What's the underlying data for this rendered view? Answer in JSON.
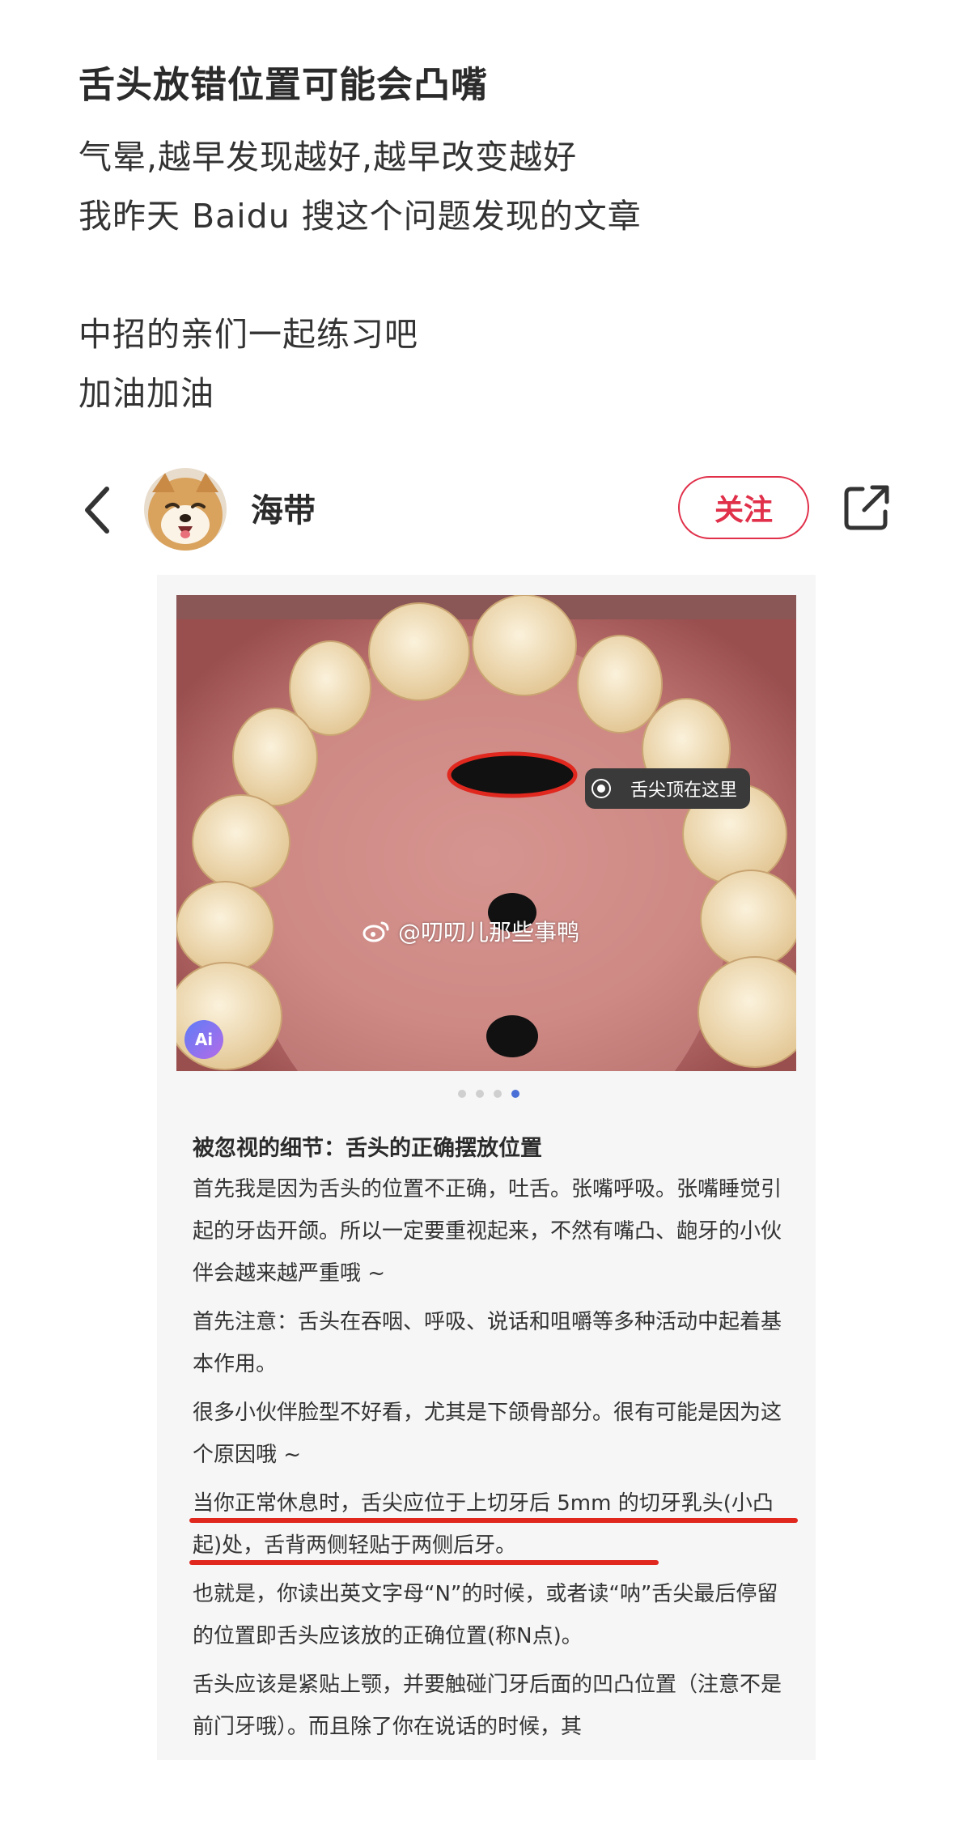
{
  "post": {
    "title": "舌头放错位置可能会凸嘴",
    "lines": [
      "气晕,越早发现越好,越早改变越好",
      "我昨天 Baidu 搜这个问题发现的文章",
      "",
      "中招的亲们一起练习吧",
      "加油加油"
    ]
  },
  "author_bar": {
    "name": "海带",
    "follow_label": "关注",
    "back_icon": "chevron-left-icon",
    "share_icon": "share-external-icon"
  },
  "embedded": {
    "tooltip": "舌尖顶在这里",
    "watermark": "@叨叨儿那些事鸭",
    "ai_badge": "Ai",
    "carousel_count": 4,
    "carousel_active": 4,
    "heading": "被忽视的细节：舌头的正确摆放位置",
    "paragraphs": [
      "首先我是因为舌头的位置不正确，吐舌。张嘴呼吸。张嘴睡觉引起的牙齿开颌。所以一定要重视起来，不然有嘴凸、龅牙的小伙伴会越来越严重哦 ~",
      "首先注意：舌头在吞咽、呼吸、说话和咀嚼等多种活动中起着基本作用。",
      "很多小伙伴脸型不好看，尤其是下颌骨部分。很有可能是因为这个原因哦 ~",
      "当你正常休息时，舌尖应位于上切牙后 5mm 的切牙乳头(小凸起)处，舌背两侧轻贴于两侧后牙。",
      "也就是，你读出英文字母“N”的时候，或者读“呐”舌尖最后停留的位置即舌头应该放的正确位置(称N点)。",
      "舌头应该是紧贴上颚，并要触碰门牙后面的凹凸位置（注意不是前门牙哦）。而且除了你在说话的时候，其"
    ],
    "colors": {
      "underline": "#e0281f",
      "follow": "#e0304a",
      "active_dot": "#4a6fd6"
    }
  }
}
